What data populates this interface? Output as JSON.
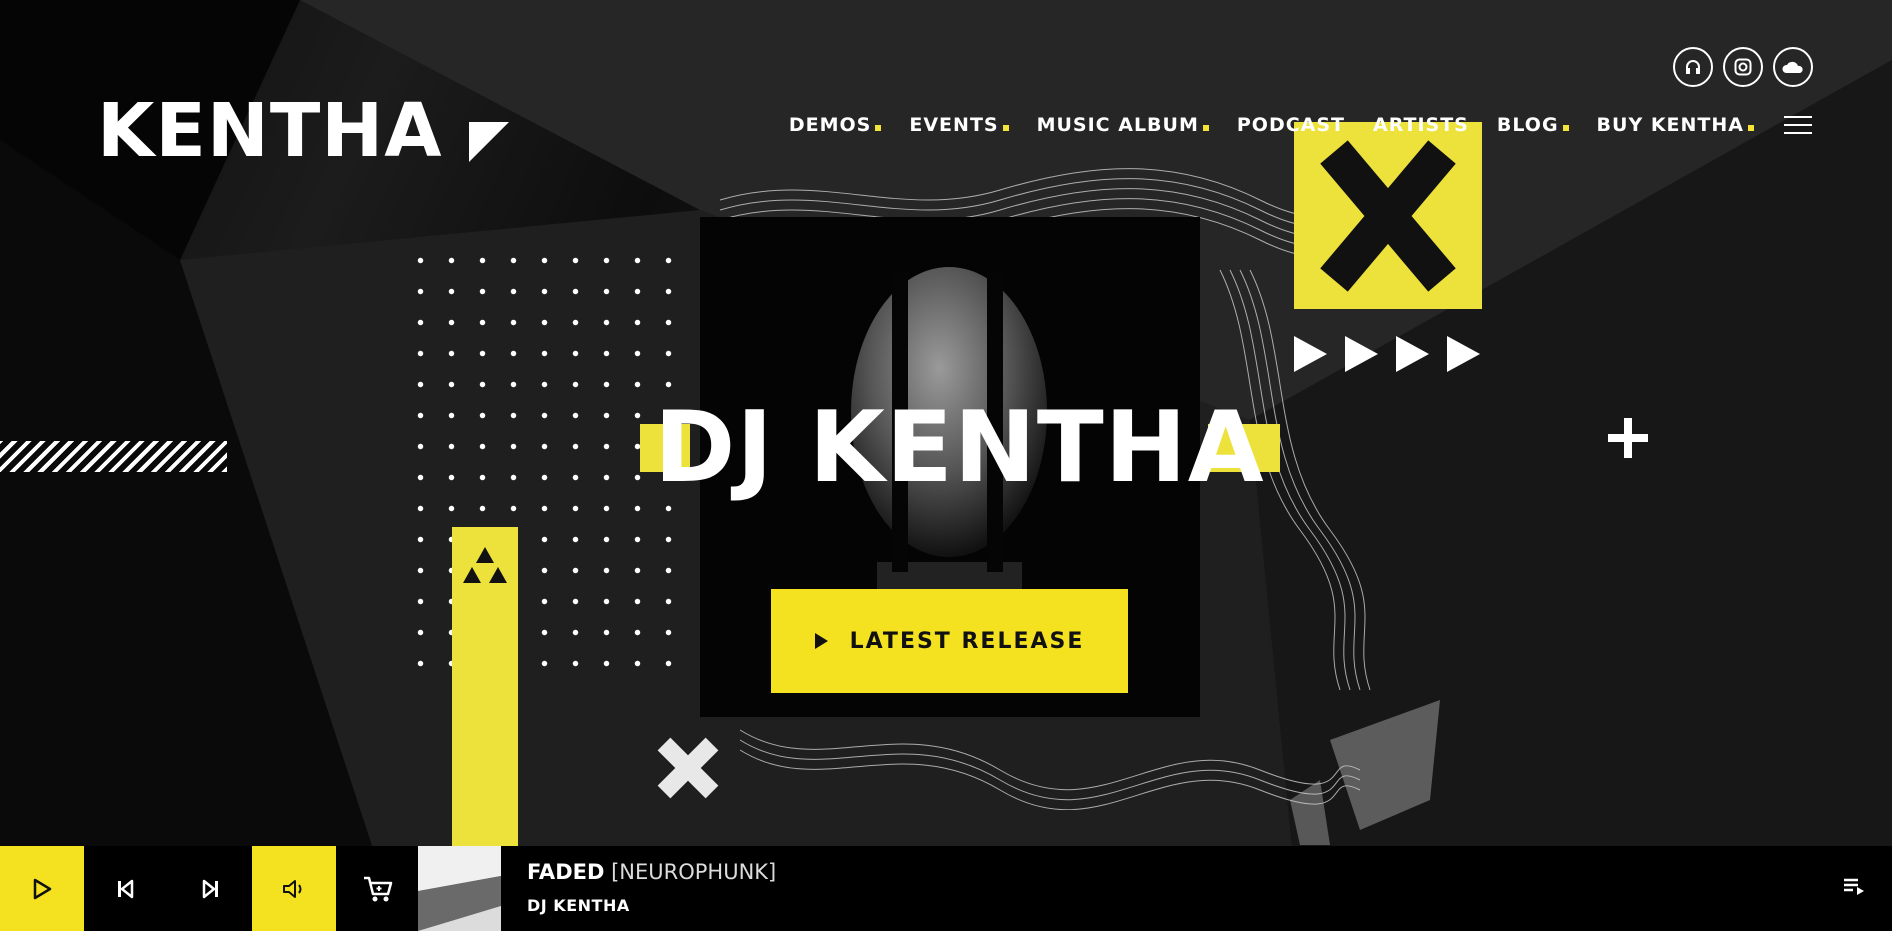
{
  "brand": {
    "logo": "KENTHA",
    "accent": "#f4e221"
  },
  "social": [
    {
      "name": "headphones-icon"
    },
    {
      "name": "instagram-icon"
    },
    {
      "name": "soundcloud-icon"
    }
  ],
  "nav": {
    "items": [
      {
        "label": "DEMOS",
        "dot": true
      },
      {
        "label": "EVENTS",
        "dot": true
      },
      {
        "label": "MUSIC ALBUM",
        "dot": true
      },
      {
        "label": "PODCAST",
        "dot": false
      },
      {
        "label": "ARTISTS",
        "dot": false
      },
      {
        "label": "BLOG",
        "dot": true
      },
      {
        "label": "BUY KENTHA",
        "dot": true
      }
    ]
  },
  "hero": {
    "title": "DJ KENTHA",
    "cta_label": "LATEST RELEASE"
  },
  "player": {
    "track_title": "FADED",
    "track_tag": "[NEUROPHUNK]",
    "artist": "DJ KENTHA"
  }
}
